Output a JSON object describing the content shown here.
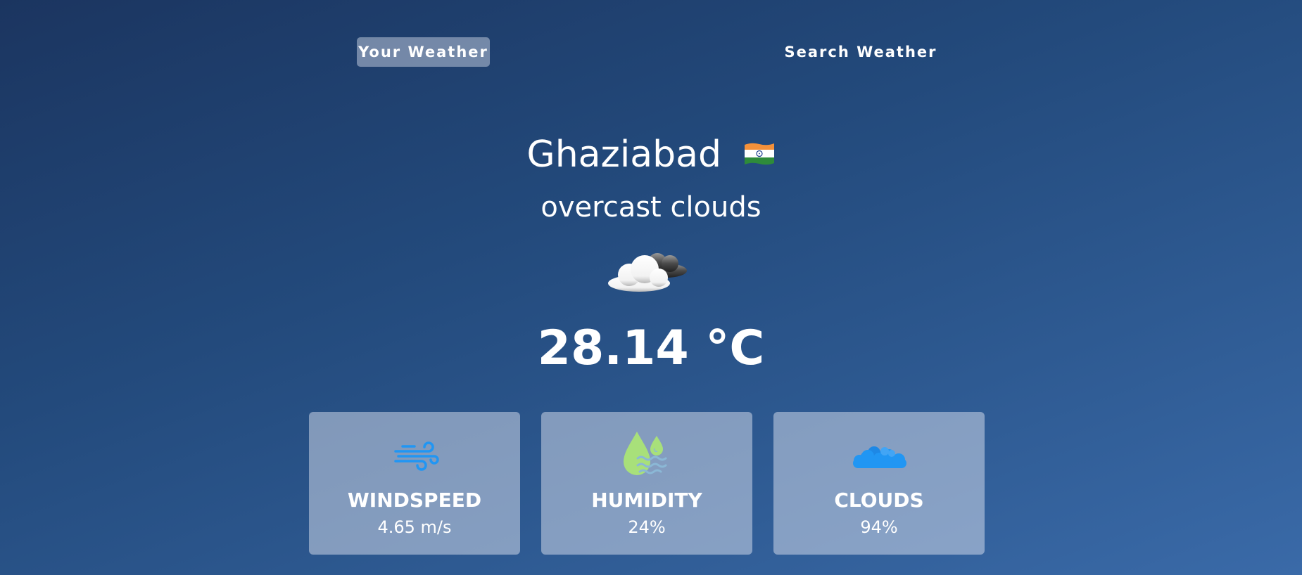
{
  "tabs": {
    "your_weather": "Your Weather",
    "search_weather": "Search Weather"
  },
  "location": {
    "city": "Ghaziabad",
    "flag_icon": "india-flag-icon"
  },
  "weather": {
    "description": "overcast clouds",
    "icon": "overcast-clouds-icon",
    "temperature": "28.14 °C"
  },
  "cards": {
    "windspeed": {
      "label": "WINDSPEED",
      "value": "4.65 m/s",
      "icon": "wind-icon"
    },
    "humidity": {
      "label": "HUMIDITY",
      "value": "24%",
      "icon": "humidity-drop-icon"
    },
    "clouds": {
      "label": "CLOUDS",
      "value": "94%",
      "icon": "clouds-icon"
    }
  },
  "colors": {
    "bg_top": "#1b3560",
    "bg_bottom": "#3a6aa8",
    "wind_icon": "#2196f3",
    "humidity_icon": "#a8e07a",
    "clouds_icon": "#2196f3"
  }
}
